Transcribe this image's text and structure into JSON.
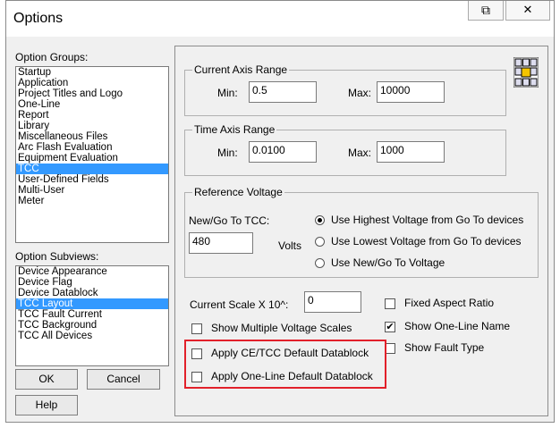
{
  "window": {
    "title": "Options",
    "restore_glyph": "⧉",
    "close_glyph": "✕"
  },
  "left": {
    "option_groups_label": "Option Groups:",
    "option_groups": [
      "Startup",
      "Application",
      "Project Titles and Logo",
      "One-Line",
      "Report",
      "Library",
      "Miscellaneous Files",
      "Arc Flash Evaluation",
      "Equipment Evaluation",
      "TCC",
      "User-Defined Fields",
      "Multi-User",
      "Meter"
    ],
    "option_groups_selected": "TCC",
    "option_subviews_label": "Option Subviews:",
    "option_subviews": [
      "Device Appearance",
      "Device Flag",
      "Device Datablock",
      "TCC Layout",
      "TCC Fault Current",
      "TCC Background",
      "TCC All Devices"
    ],
    "option_subviews_selected": "TCC Layout",
    "ok_label": "OK",
    "cancel_label": "Cancel",
    "help_label": "Help"
  },
  "current_axis": {
    "title": "Current Axis Range",
    "min_label": "Min:",
    "min_value": "0.5",
    "max_label": "Max:",
    "max_value": "10000"
  },
  "time_axis": {
    "title": "Time Axis Range",
    "min_label": "Min:",
    "min_value": "0.0100",
    "max_label": "Max:",
    "max_value": "1000"
  },
  "reference_voltage": {
    "title": "Reference Voltage",
    "new_goto_label": "New/Go To TCC:",
    "voltage_value": "480",
    "volts_label": "Volts",
    "options": [
      "Use Highest  Voltage from Go To devices",
      "Use Lowest Voltage from Go To devices",
      "Use New/Go To Voltage"
    ],
    "selected_index": 0
  },
  "scale": {
    "label": "Current Scale X 10^:",
    "value": "0"
  },
  "checkboxes": {
    "show_multiple_voltage_scales": {
      "label": "Show Multiple Voltage Scales",
      "checked": false
    },
    "apply_ce_tcc_default": {
      "label": "Apply CE/TCC Default Datablock",
      "checked": false
    },
    "apply_one_line_default": {
      "label": "Apply One-Line Default Datablock",
      "checked": false
    },
    "fixed_aspect_ratio": {
      "label": "Fixed Aspect Ratio",
      "checked": false
    },
    "show_one_line_name": {
      "label": "Show One-Line Name",
      "checked": true
    },
    "show_fault_type": {
      "label": "Show Fault Type",
      "checked": false
    }
  },
  "colors": {
    "selection": "#3399ff",
    "highlight_box": "#e2202a"
  }
}
